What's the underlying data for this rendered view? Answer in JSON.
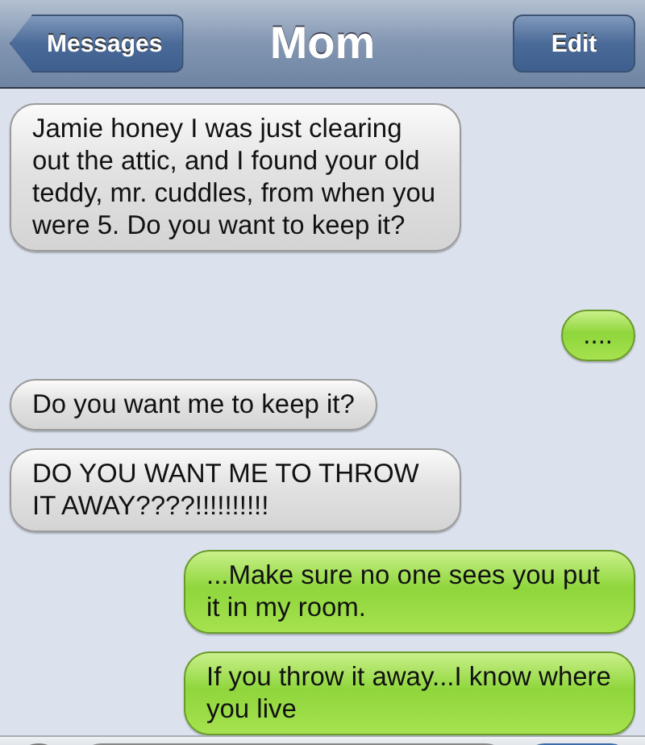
{
  "nav_bar": {
    "back_button": "Messages",
    "title": "Mom",
    "edit_button": "Edit"
  },
  "messages": [
    {
      "kind": "received",
      "text": "Jamie honey I was just clearing out the attic, and I found your old teddy, mr. cuddles, from when you were 5. Do you want to keep it?"
    },
    {
      "kind": "sent",
      "text": "...."
    },
    {
      "kind": "received",
      "text": "Do you want me to keep it?"
    },
    {
      "kind": "received",
      "text": "DO YOU WANT ME TO THROW IT AWAY????!!!!!!!!!!"
    },
    {
      "kind": "sent",
      "text": "...Make sure no one sees you put it in my room."
    },
    {
      "kind": "sent",
      "text": "If you throw it away...I know where you live"
    }
  ]
}
